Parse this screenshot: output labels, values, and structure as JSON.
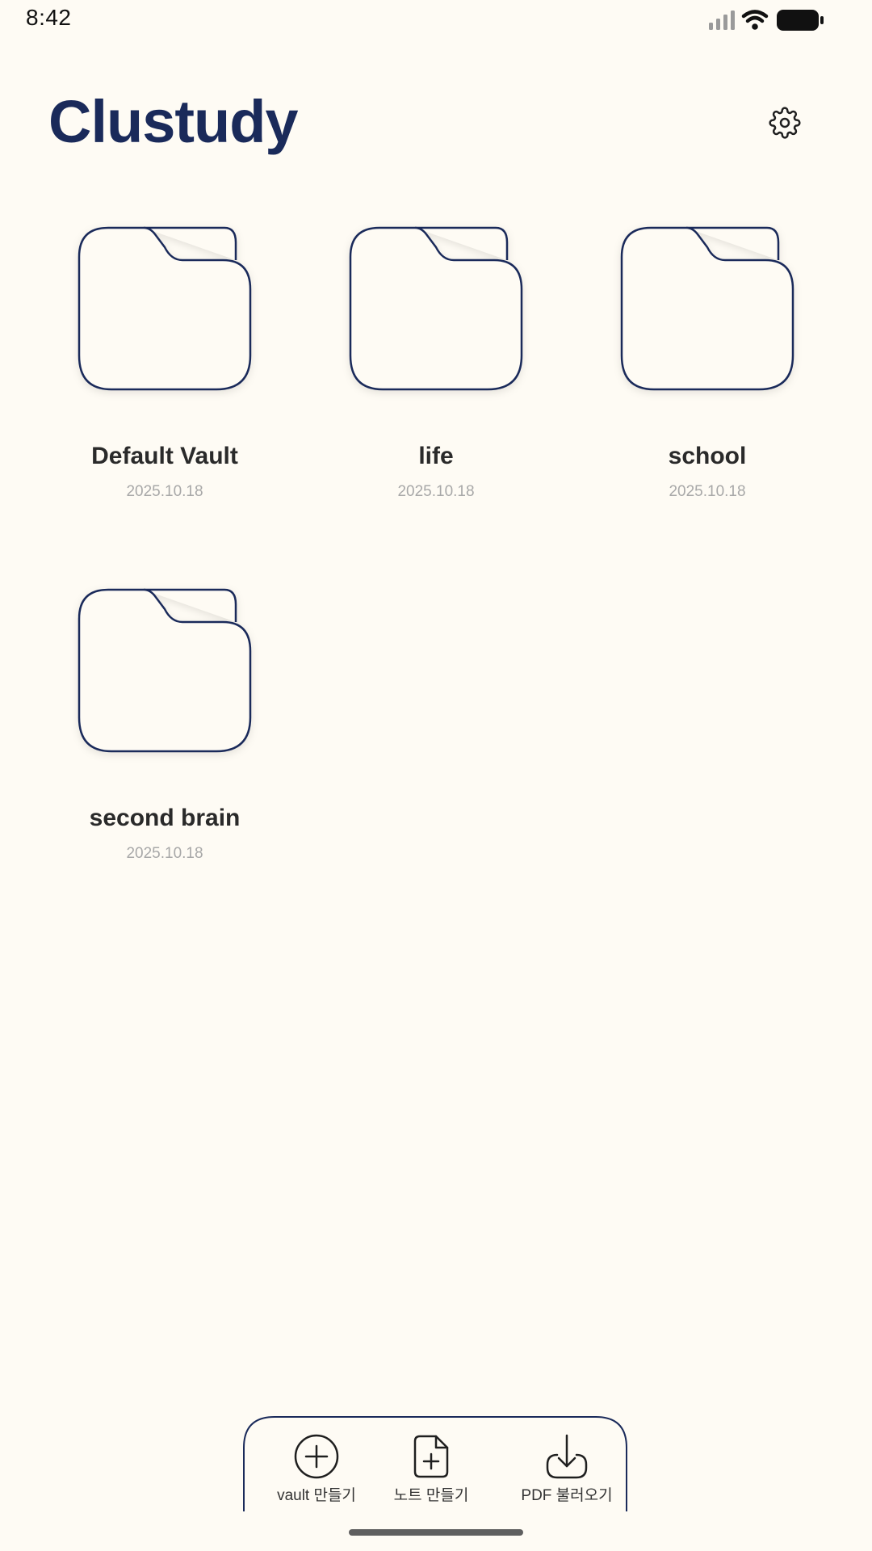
{
  "status_bar": {
    "time": "8:42",
    "signal_icon": "signal-bars-icon",
    "wifi_icon": "wifi-icon",
    "battery_icon": "battery-icon"
  },
  "header": {
    "title": "Clustudy",
    "settings_icon": "gear-icon"
  },
  "vaults": [
    {
      "name": "Default Vault",
      "date": "2025.10.18",
      "icon": "folder-icon"
    },
    {
      "name": "life",
      "date": "2025.10.18",
      "icon": "folder-icon"
    },
    {
      "name": "school",
      "date": "2025.10.18",
      "icon": "folder-icon"
    },
    {
      "name": "second brain",
      "date": "2025.10.18",
      "icon": "folder-icon"
    }
  ],
  "bottom_bar": {
    "create_vault_label": "vault 만들기",
    "create_note_label": "노트 만들기",
    "import_pdf_label": "PDF 불러오기",
    "create_vault_icon": "plus-circle-icon",
    "create_note_icon": "file-plus-icon",
    "import_pdf_icon": "download-icon"
  },
  "colors": {
    "background": "#FEFBF4",
    "title": "#1A2A5A",
    "folder_stroke": "#1A2A5A",
    "vault_name": "#2A2A2A",
    "vault_date": "#A8A8A8"
  }
}
